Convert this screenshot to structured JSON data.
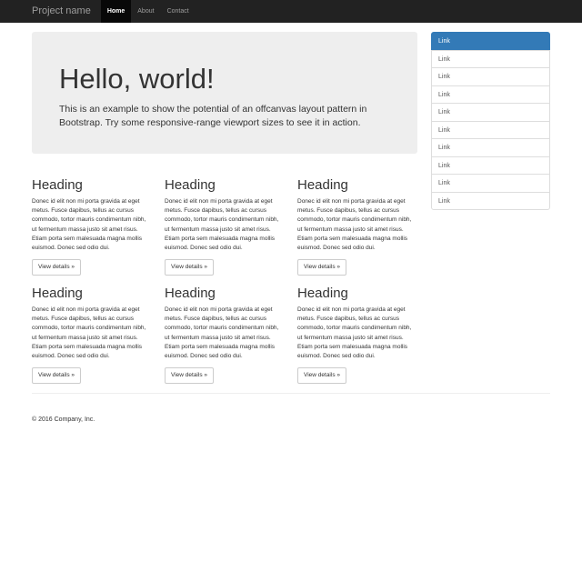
{
  "navbar": {
    "brand": "Project name",
    "links": [
      "Home",
      "About",
      "Contact"
    ]
  },
  "jumbotron": {
    "title": "Hello, world!",
    "text": "This is an example to show the potential of an offcanvas layout pattern in Bootstrap. Try some responsive-range viewport sizes to see it in action."
  },
  "cards": [
    {
      "heading": "Heading",
      "text": "Donec id elit non mi porta gravida at eget metus. Fusce dapibus, tellus ac cursus commodo, tortor mauris condimentum nibh, ut fermentum massa justo sit amet risus. Etiam porta sem malesuada magna mollis euismod. Donec sed odio dui.",
      "button": "View details »"
    },
    {
      "heading": "Heading",
      "text": "Donec id elit non mi porta gravida at eget metus. Fusce dapibus, tellus ac cursus commodo, tortor mauris condimentum nibh, ut fermentum massa justo sit amet risus. Etiam porta sem malesuada magna mollis euismod. Donec sed odio dui.",
      "button": "View details »"
    },
    {
      "heading": "Heading",
      "text": "Donec id elit non mi porta gravida at eget metus. Fusce dapibus, tellus ac cursus commodo, tortor mauris condimentum nibh, ut fermentum massa justo sit amet risus. Etiam porta sem malesuada magna mollis euismod. Donec sed odio dui.",
      "button": "View details »"
    },
    {
      "heading": "Heading",
      "text": "Donec id elit non mi porta gravida at eget metus. Fusce dapibus, tellus ac cursus commodo, tortor mauris condimentum nibh, ut fermentum massa justo sit amet risus. Etiam porta sem malesuada magna mollis euismod. Donec sed odio dui.",
      "button": "View details »"
    },
    {
      "heading": "Heading",
      "text": "Donec id elit non mi porta gravida at eget metus. Fusce dapibus, tellus ac cursus commodo, tortor mauris condimentum nibh, ut fermentum massa justo sit amet risus. Etiam porta sem malesuada magna mollis euismod. Donec sed odio dui.",
      "button": "View details »"
    },
    {
      "heading": "Heading",
      "text": "Donec id elit non mi porta gravida at eget metus. Fusce dapibus, tellus ac cursus commodo, tortor mauris condimentum nibh, ut fermentum massa justo sit amet risus. Etiam porta sem malesuada magna mollis euismod. Donec sed odio dui.",
      "button": "View details »"
    }
  ],
  "sidebar": {
    "links": [
      "Link",
      "Link",
      "Link",
      "Link",
      "Link",
      "Link",
      "Link",
      "Link",
      "Link",
      "Link"
    ]
  },
  "footer": {
    "text": "© 2016 Company, Inc."
  },
  "colors": {
    "navbar_bg": "#222222",
    "active_link_bg": "#337ab7",
    "jumbotron_bg": "#eeeeee"
  }
}
